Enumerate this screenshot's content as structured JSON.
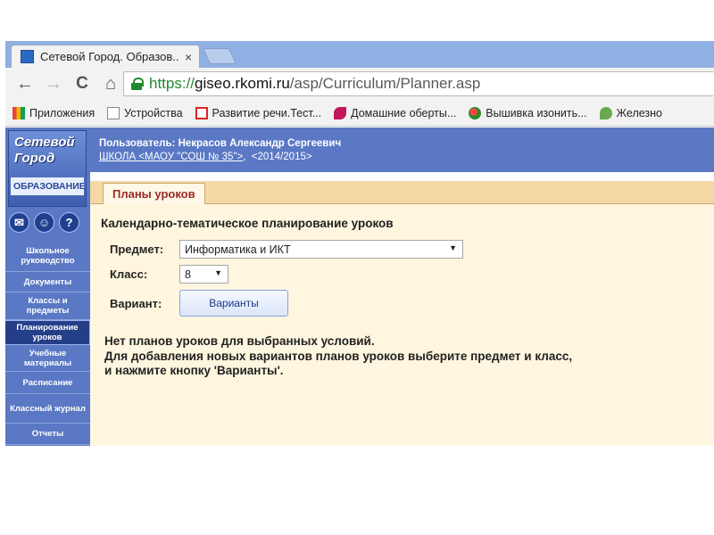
{
  "browser": {
    "tab_title": "Сетевой Город. Образов...",
    "tab_close": "×",
    "url_scheme": "https://",
    "url_host": "giseo.rkomi.ru",
    "url_path": "/asp/Curriculum/Planner.asp",
    "nav": {
      "back": "←",
      "forward": "→",
      "reload": "C",
      "home": "⌂"
    }
  },
  "bookmarks": [
    {
      "label": "Приложения",
      "icon": "apps-icon"
    },
    {
      "label": "Устройства",
      "icon": "page-icon"
    },
    {
      "label": "Развитие речи.Тест...",
      "icon": "test-icon"
    },
    {
      "label": "Домашние оберты...",
      "icon": "lips-icon"
    },
    {
      "label": "Вышивка изонить...",
      "icon": "ball-icon"
    },
    {
      "label": "Железно",
      "icon": "leaf-icon"
    }
  ],
  "logo": {
    "line1": "Сетевой",
    "line2": "Город",
    "line3": "ОБРАЗОВАНИЕ"
  },
  "sidebar": {
    "icons": [
      {
        "glyph": "✉",
        "name": "mail-icon"
      },
      {
        "glyph": "☺",
        "name": "users-icon"
      },
      {
        "glyph": "?",
        "name": "help-icon"
      }
    ],
    "items": [
      {
        "label": "Школьное руководство",
        "active": false
      },
      {
        "label": "Документы",
        "active": false
      },
      {
        "label": "Классы и предметы",
        "active": false
      },
      {
        "label": "Планирование уроков",
        "active": true
      },
      {
        "label": "Учебные материалы",
        "active": false
      },
      {
        "label": "Расписание",
        "active": false
      },
      {
        "label": "Классный журнал",
        "active": false
      },
      {
        "label": "Отчеты",
        "active": false
      }
    ]
  },
  "header": {
    "user": "Пользователь: Некрасов Александр Сергеевич",
    "school_link": "ШКОЛА <МАОУ \"СОШ № 35\">",
    "year": "<2014/2015>"
  },
  "page_tab": "Планы уроков",
  "content": {
    "title": "Календарно-тематическое планирование уроков",
    "subject_label": "Предмет:",
    "subject_value": "Информатика и ИКТ",
    "class_label": "Класс:",
    "class_value": "8",
    "variant_label": "Вариант:",
    "variant_button": "Варианты",
    "message_1": "Нет планов уроков для выбранных условий.",
    "message_2": "Для добавления новых вариантов планов уроков выберите предмет и класс,",
    "message_3": "и нажмите кнопку 'Варианты'."
  }
}
